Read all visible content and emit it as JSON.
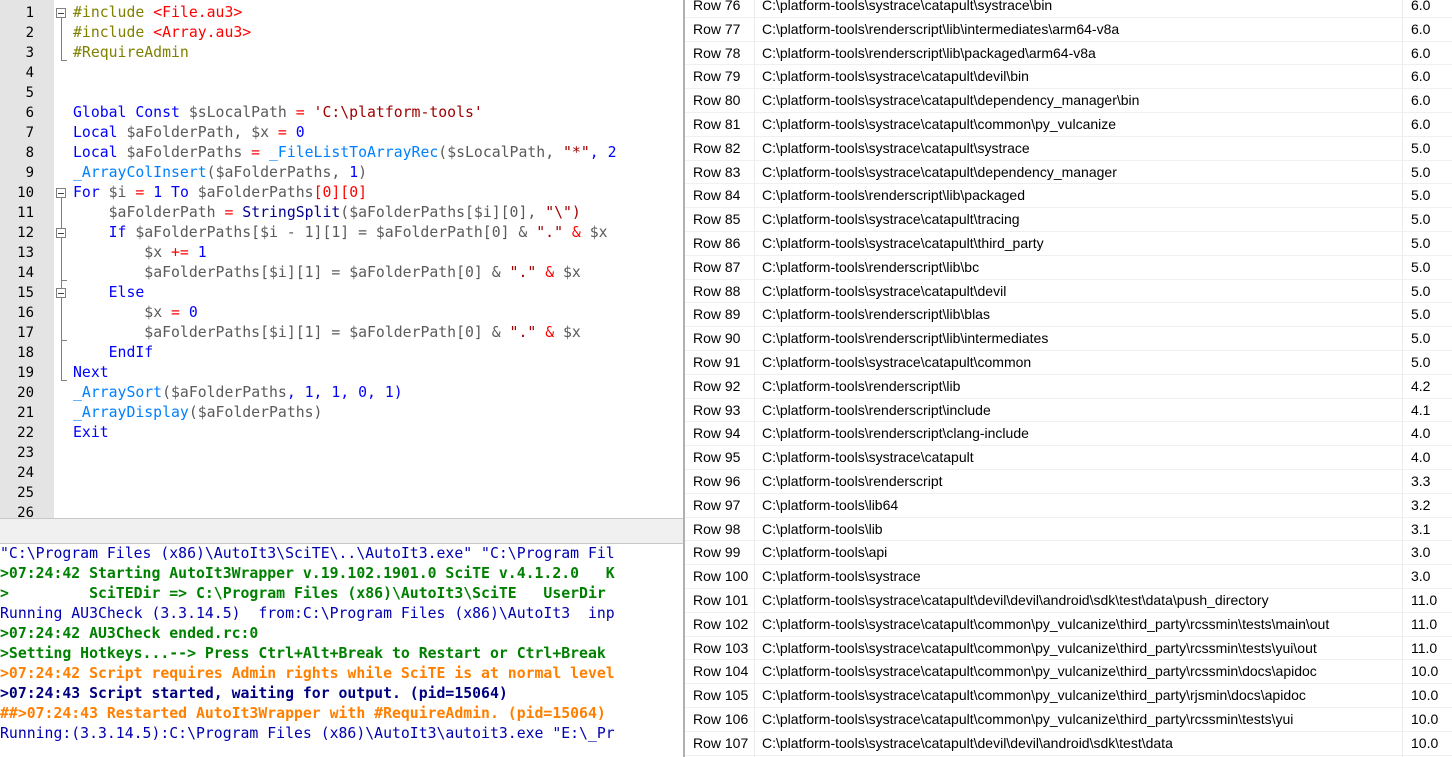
{
  "editor": {
    "line_numbers": [
      "1",
      "2",
      "3",
      "4",
      "5",
      "6",
      "7",
      "8",
      "9",
      "10",
      "11",
      "12",
      "13",
      "14",
      "15",
      "16",
      "17",
      "18",
      "19",
      "20",
      "21",
      "22",
      "23",
      "24",
      "25",
      "26"
    ],
    "l1a": "#include ",
    "l1b": "<File.au3>",
    "l2a": "#include ",
    "l2b": "<Array.au3>",
    "l3": "#RequireAdmin",
    "l6a": "Global Const ",
    "l6b": "$sLocalPath",
    "l6c": " = ",
    "l6d": "'C:\\platform-tools'",
    "l7a": "Local ",
    "l7b": "$aFolderPath",
    "l7c": ", ",
    "l7d": "$x",
    "l7e": " = ",
    "l7f": "0",
    "l8a": "Local ",
    "l8b": "$aFolderPaths",
    "l8c": " = ",
    "l8d": "_FileListToArrayRec",
    "l8e": "(",
    "l8f": "$sLocalPath",
    "l8g": ", ",
    "l8h": "\"*\"",
    "l8i": ", 2",
    "l9a": "_ArrayColInsert",
    "l9b": "(",
    "l9c": "$aFolderPaths",
    "l9d": ", ",
    "l9e": "1",
    "l9f": ")",
    "l10a": "For ",
    "l10b": "$i",
    "l10c": " = ",
    "l10d": "1",
    "l10e": " To ",
    "l10f": "$aFolderPaths",
    "l10g": "[0][0]",
    "l11a": "    ",
    "l11b": "$aFolderPath",
    "l11c": " = ",
    "l11d": "StringSplit",
    "l11e": "(",
    "l11f": "$aFolderPaths",
    "l11g": "[$i][0], ",
    "l11h": "\"\\\")",
    "l12a": "    If ",
    "l12b": "$aFolderPaths",
    "l12c": "[$i - 1][1] = ",
    "l12d": "$aFolderPath",
    "l12e": "[0] & ",
    "l12f": "\".\"",
    "l12g": " & ",
    "l12h": "$x",
    "l13a": "        ",
    "l13b": "$x",
    "l13c": " += ",
    "l13d": "1",
    "l14a": "        ",
    "l14b": "$aFolderPaths",
    "l14c": "[$i][1] = ",
    "l14d": "$aFolderPath",
    "l14e": "[0] & ",
    "l14f": "\".\"",
    "l14g": " & ",
    "l14h": "$x",
    "l15": "    Else",
    "l16a": "        ",
    "l16b": "$x",
    "l16c": " = ",
    "l16d": "0",
    "l17a": "        ",
    "l17b": "$aFolderPaths",
    "l17c": "[$i][1] = ",
    "l17d": "$aFolderPath",
    "l17e": "[0] & ",
    "l17f": "\".\"",
    "l17g": " & ",
    "l17h": "$x",
    "l18": "    EndIf",
    "l19": "Next",
    "l20a": "_ArraySort",
    "l20b": "(",
    "l20c": "$aFolderPaths",
    "l20d": ", 1, 1, 0, 1)",
    "l21a": "_ArrayDisplay",
    "l21b": "(",
    "l21c": "$aFolderPaths",
    "l21d": ")",
    "l22": "Exit"
  },
  "output": {
    "o1": "\"C:\\Program Files (x86)\\AutoIt3\\SciTE\\..\\AutoIt3.exe\" \"C:\\Program Fil",
    "o2": ">07:24:42 Starting AutoIt3Wrapper v.19.102.1901.0 SciTE v.4.1.2.0   K",
    "o3": ">         SciTEDir => C:\\Program Files (x86)\\AutoIt3\\SciTE   UserDir",
    "o4": "Running AU3Check (3.3.14.5)  from:C:\\Program Files (x86)\\AutoIt3  inp",
    "o5": ">07:24:42 AU3Check ended.rc:0",
    "o6": ">Setting Hotkeys...--> Press Ctrl+Alt+Break to Restart or Ctrl+Break",
    "o7": ">07:24:42 Script requires Admin rights while SciTE is at normal level",
    "o8": ">07:24:43 Script started, waiting for output. (pid=15064)",
    "o9": "##>07:24:43 Restarted AutoIt3Wrapper with #RequireAdmin. (pid=15064)",
    "o10": "Running:(3.3.14.5):C:\\Program Files (x86)\\AutoIt3\\autoit3.exe \"E:\\_Pr"
  },
  "table": {
    "rows": [
      [
        "Row 76",
        "C:\\platform-tools\\systrace\\catapult\\systrace\\bin",
        "6.0"
      ],
      [
        "Row 77",
        "C:\\platform-tools\\renderscript\\lib\\intermediates\\arm64-v8a",
        "6.0"
      ],
      [
        "Row 78",
        "C:\\platform-tools\\renderscript\\lib\\packaged\\arm64-v8a",
        "6.0"
      ],
      [
        "Row 79",
        "C:\\platform-tools\\systrace\\catapult\\devil\\bin",
        "6.0"
      ],
      [
        "Row 80",
        "C:\\platform-tools\\systrace\\catapult\\dependency_manager\\bin",
        "6.0"
      ],
      [
        "Row 81",
        "C:\\platform-tools\\systrace\\catapult\\common\\py_vulcanize",
        "6.0"
      ],
      [
        "Row 82",
        "C:\\platform-tools\\systrace\\catapult\\systrace",
        "5.0"
      ],
      [
        "Row 83",
        "C:\\platform-tools\\systrace\\catapult\\dependency_manager",
        "5.0"
      ],
      [
        "Row 84",
        "C:\\platform-tools\\renderscript\\lib\\packaged",
        "5.0"
      ],
      [
        "Row 85",
        "C:\\platform-tools\\systrace\\catapult\\tracing",
        "5.0"
      ],
      [
        "Row 86",
        "C:\\platform-tools\\systrace\\catapult\\third_party",
        "5.0"
      ],
      [
        "Row 87",
        "C:\\platform-tools\\renderscript\\lib\\bc",
        "5.0"
      ],
      [
        "Row 88",
        "C:\\platform-tools\\systrace\\catapult\\devil",
        "5.0"
      ],
      [
        "Row 89",
        "C:\\platform-tools\\renderscript\\lib\\blas",
        "5.0"
      ],
      [
        "Row 90",
        "C:\\platform-tools\\renderscript\\lib\\intermediates",
        "5.0"
      ],
      [
        "Row 91",
        "C:\\platform-tools\\systrace\\catapult\\common",
        "5.0"
      ],
      [
        "Row 92",
        "C:\\platform-tools\\renderscript\\lib",
        "4.2"
      ],
      [
        "Row 93",
        "C:\\platform-tools\\renderscript\\include",
        "4.1"
      ],
      [
        "Row 94",
        "C:\\platform-tools\\renderscript\\clang-include",
        "4.0"
      ],
      [
        "Row 95",
        "C:\\platform-tools\\systrace\\catapult",
        "4.0"
      ],
      [
        "Row 96",
        "C:\\platform-tools\\renderscript",
        "3.3"
      ],
      [
        "Row 97",
        "C:\\platform-tools\\lib64",
        "3.2"
      ],
      [
        "Row 98",
        "C:\\platform-tools\\lib",
        "3.1"
      ],
      [
        "Row 99",
        "C:\\platform-tools\\api",
        "3.0"
      ],
      [
        "Row 100",
        "C:\\platform-tools\\systrace",
        "3.0"
      ],
      [
        "Row 101",
        "C:\\platform-tools\\systrace\\catapult\\devil\\devil\\android\\sdk\\test\\data\\push_directory",
        "11.0"
      ],
      [
        "Row 102",
        "C:\\platform-tools\\systrace\\catapult\\common\\py_vulcanize\\third_party\\rcssmin\\tests\\main\\out",
        "11.0"
      ],
      [
        "Row 103",
        "C:\\platform-tools\\systrace\\catapult\\common\\py_vulcanize\\third_party\\rcssmin\\tests\\yui\\out",
        "11.0"
      ],
      [
        "Row 104",
        "C:\\platform-tools\\systrace\\catapult\\common\\py_vulcanize\\third_party\\rcssmin\\docs\\apidoc",
        "10.0"
      ],
      [
        "Row 105",
        "C:\\platform-tools\\systrace\\catapult\\common\\py_vulcanize\\third_party\\rjsmin\\docs\\apidoc",
        "10.0"
      ],
      [
        "Row 106",
        "C:\\platform-tools\\systrace\\catapult\\common\\py_vulcanize\\third_party\\rcssmin\\tests\\yui",
        "10.0"
      ],
      [
        "Row 107",
        "C:\\platform-tools\\systrace\\catapult\\devil\\devil\\android\\sdk\\test\\data",
        "10.0"
      ]
    ]
  }
}
